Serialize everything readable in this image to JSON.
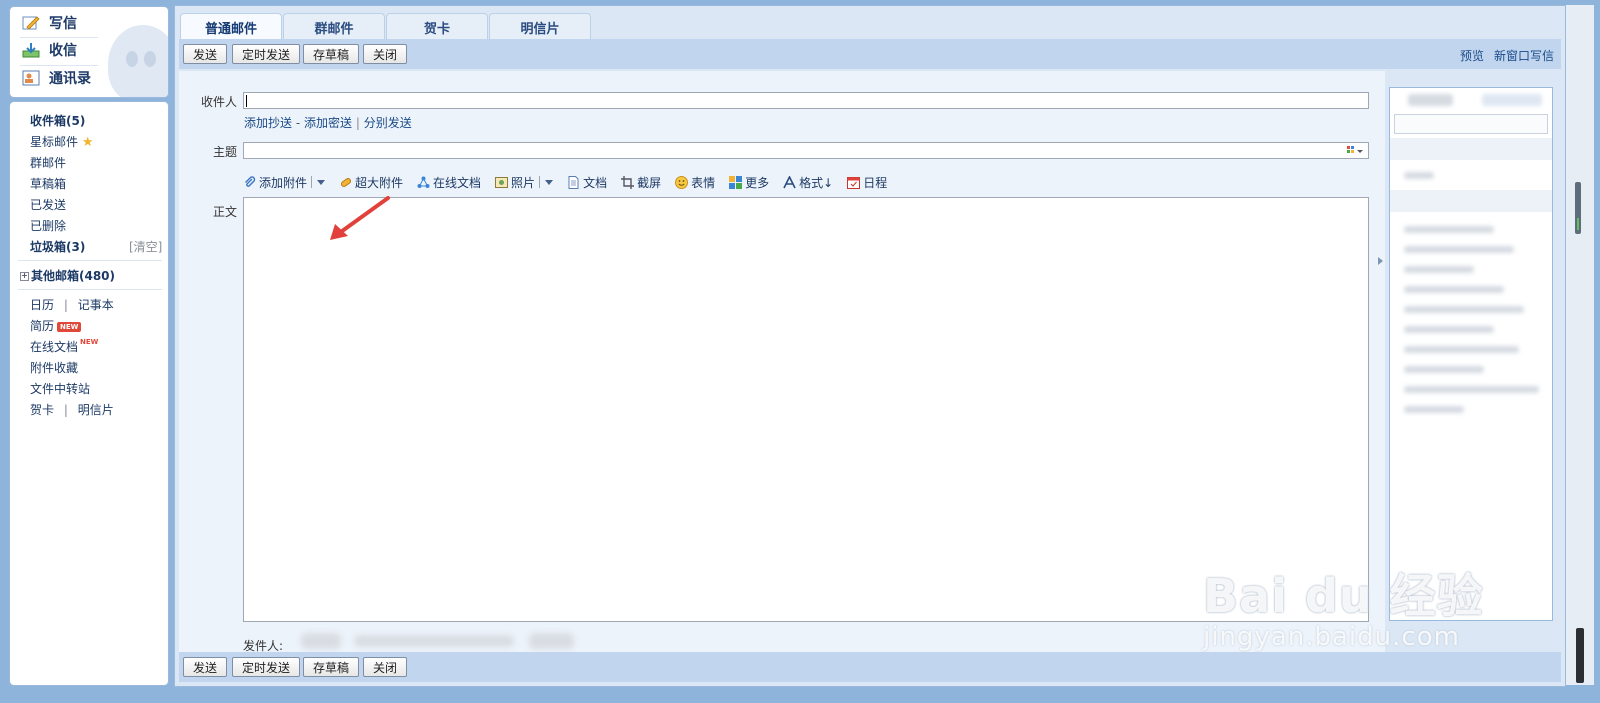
{
  "quick": {
    "write": "写信",
    "receive": "收信",
    "contacts": "通讯录"
  },
  "folders": {
    "inbox": "收件箱(5)",
    "starred": "星标邮件",
    "group": "群邮件",
    "drafts": "草稿箱",
    "sent": "已发送",
    "deleted": "已删除",
    "spam": "垃圾箱(3)",
    "spam_clear": "[清空]",
    "other": "其他邮箱(480)",
    "calendar": "日历",
    "divider": "|",
    "notebook": "记事本",
    "resume": "简历",
    "new_badge": "NEW",
    "online_docs": "在线文档",
    "attachments": "附件收藏",
    "file_transfer": "文件中转站",
    "greeting_card": "贺卡",
    "postcard": "明信片"
  },
  "tabs": [
    "普通邮件",
    "群邮件",
    "贺卡",
    "明信片"
  ],
  "toolbar": {
    "send": "发送",
    "scheduled_send": "定时发送",
    "save_draft": "存草稿",
    "close": "关闭",
    "preview": "预览",
    "new_window": "新窗口写信"
  },
  "compose": {
    "to_label": "收件人",
    "add_cc": "添加抄送",
    "dash": "-",
    "add_bcc": "添加密送",
    "bar": "|",
    "separate_send": "分别发送",
    "subject_label": "主题",
    "body_label": "正文",
    "sender_label": "发件人:"
  },
  "tools": {
    "add_attachment": "添加附件",
    "big_attachment": "超大附件",
    "online_doc": "在线文档",
    "photo": "照片",
    "document": "文档",
    "screenshot": "截屏",
    "emoticon": "表情",
    "more": "更多",
    "format": "格式↓",
    "schedule": "日程"
  },
  "watermark": {
    "main": "Bai du 经验",
    "sub": "jingyan.baidu.com"
  },
  "colors": {
    "accent": "#163a73",
    "arrow": "#e2413b",
    "new_badge": "#e0483a"
  }
}
